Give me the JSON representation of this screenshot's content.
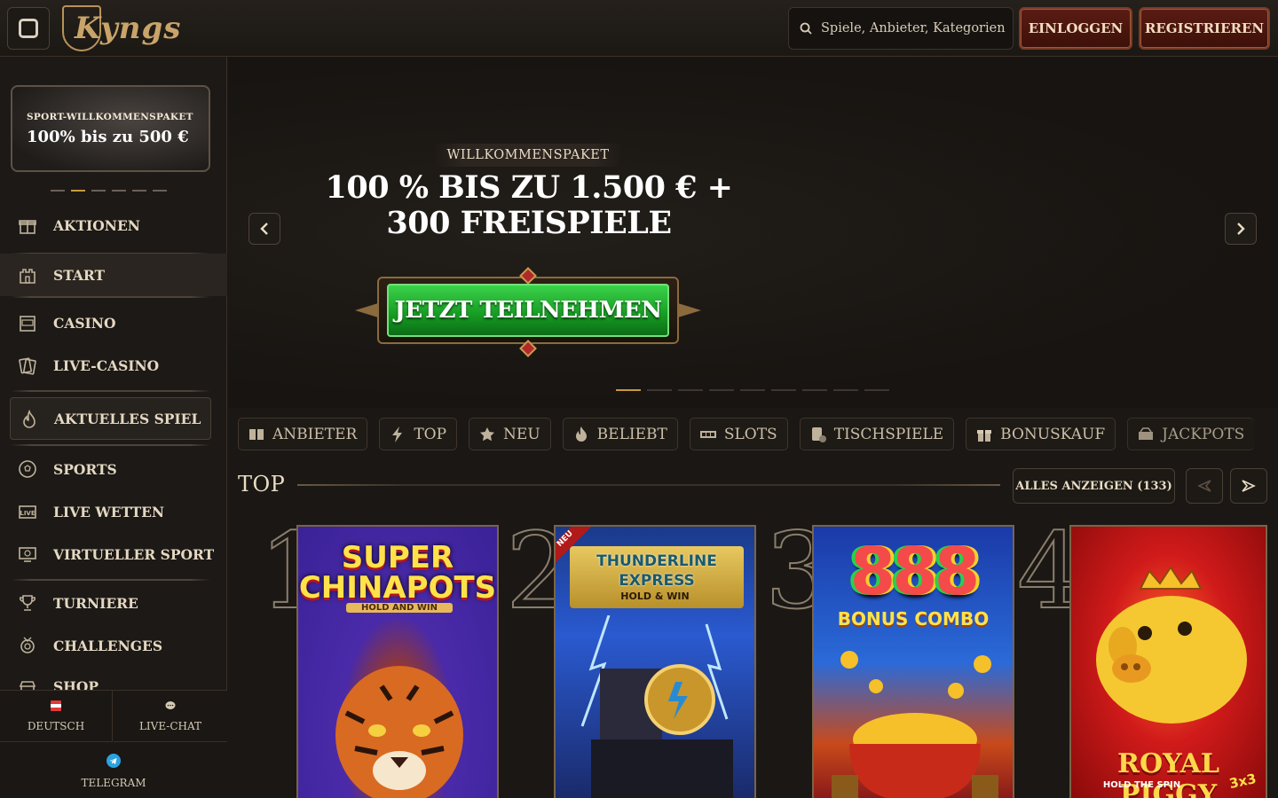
{
  "header": {
    "logo_text": "Kyngs",
    "search_placeholder": "Spiele, Anbieter, Kategorien",
    "login_label": "EINLOGGEN",
    "register_label": "REGISTRIEREN"
  },
  "sidebar": {
    "promo": {
      "line1": "SPORT-WILLKOMMENSPAKET",
      "line2": "100% bis zu 500 €"
    },
    "items": [
      {
        "label": "AKTIONEN",
        "icon": "gift-icon"
      },
      {
        "label": "START",
        "icon": "castle-icon"
      },
      {
        "label": "CASINO",
        "icon": "slot-machine-icon"
      },
      {
        "label": "LIVE-CASINO",
        "icon": "cards-icon"
      },
      {
        "label": "AKTUELLES SPIEL",
        "icon": "flame-icon"
      },
      {
        "label": "SPORTS",
        "icon": "soccer-ball-icon"
      },
      {
        "label": "LIVE WETTEN",
        "icon": "live-icon"
      },
      {
        "label": "VIRTUELLER SPORT",
        "icon": "monitor-icon"
      },
      {
        "label": "TURNIERE",
        "icon": "trophy-icon"
      },
      {
        "label": "CHALLENGES",
        "icon": "medal-icon"
      },
      {
        "label": "SHOP",
        "icon": "shop-icon"
      }
    ],
    "bottom": {
      "language": "DEUTSCH",
      "chat": "LIVE-CHAT",
      "telegram": "TELEGRAM"
    }
  },
  "hero": {
    "tag": "WILLKOMMENSPAKET",
    "title_line1": "100 % BIS ZU 1.500 € +",
    "title_line2": "300 FREISPIELE",
    "cta": "JETZT TEILNEHMEN",
    "active_slide": 1,
    "slide_count": 9
  },
  "categories": [
    {
      "label": "ANBIETER",
      "icon": "book-icon"
    },
    {
      "label": "TOP",
      "icon": "lightning-icon"
    },
    {
      "label": "NEU",
      "icon": "star-icon"
    },
    {
      "label": "BELIEBT",
      "icon": "fire-icon"
    },
    {
      "label": "SLOTS",
      "icon": "slots-icon"
    },
    {
      "label": "TISCHSPIELE",
      "icon": "dice-icon"
    },
    {
      "label": "BONUSKAUF",
      "icon": "gift-box-icon"
    },
    {
      "label": "JACKPOTS",
      "icon": "jackpot-icon"
    }
  ],
  "top_section": {
    "title": "TOP",
    "show_all": "ALLES ANZEIGEN (133)",
    "games": [
      {
        "rank": "1",
        "title": "SUPER CHINAPOTS",
        "subtitle": "HOLD AND WIN",
        "badge": ""
      },
      {
        "rank": "2",
        "title": "THUNDERLINE EXPRESS",
        "subtitle": "HOLD & WIN",
        "badge": "NEU"
      },
      {
        "rank": "3",
        "title": "888",
        "subtitle": "BONUS COMBO",
        "badge": ""
      },
      {
        "rank": "4",
        "title": "ROYAL PIGGY",
        "subtitle": "HOLD THE SPIN",
        "badge": "3x3"
      }
    ]
  },
  "colors": {
    "accent_gold": "#c89a3e",
    "cta_green": "#1fa52c",
    "register_red": "#5a1c14",
    "background": "#1a1714"
  }
}
